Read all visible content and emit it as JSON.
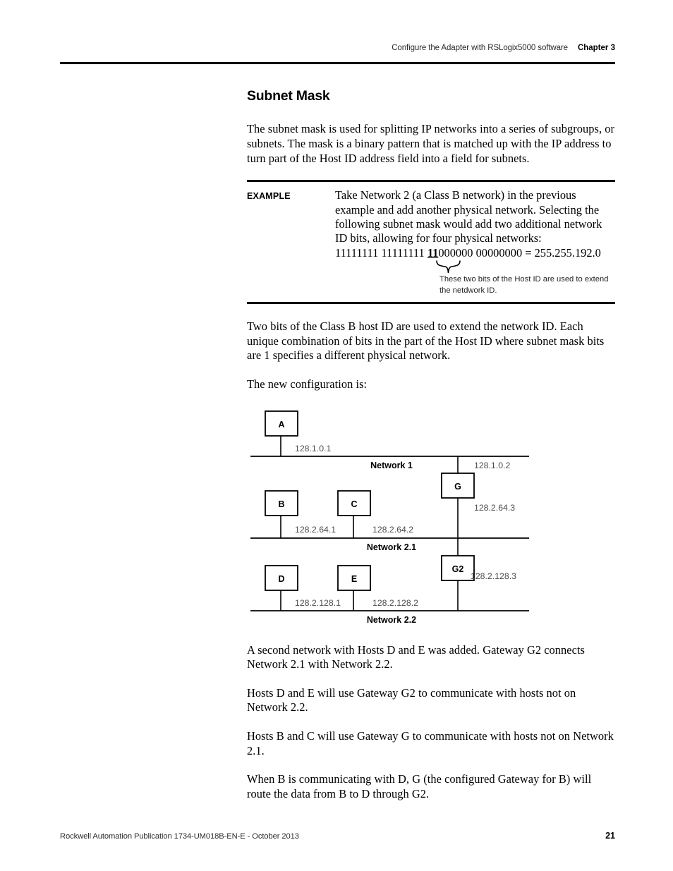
{
  "header": {
    "title": "Configure the Adapter with RSLogix5000 software",
    "chapter": "Chapter 3"
  },
  "section": {
    "title": "Subnet Mask",
    "intro": "The subnet mask is used for splitting IP networks into a series of subgroups, or subnets. The mask is a binary pattern that is matched up with the IP address to turn part of the Host ID address field into a field for subnets."
  },
  "example": {
    "label": "EXAMPLE",
    "text": "Take Network 2 (a Class B network) in the previous example and add another physical network. Selecting the following subnet mask would add two additional network ID bits, allowing for four physical networks:",
    "binary_prefix": "11111111 11111111 ",
    "binary_highlight": "11",
    "binary_suffix": "000000 00000000 = 255.255.192.0",
    "note": "These two bits of the Host ID are used to extend the netdwork ID."
  },
  "paragraphs": {
    "after_example": "Two bits of the Class B host ID are used to extend the network ID. Each unique combination of bits in the part of the Host ID where subnet mask bits are 1 specifies a different physical network.",
    "lead_in": "The new configuration is:",
    "p1": "A second network with Hosts D and E was added. Gateway G2 connects Network 2.1 with Network 2.2.",
    "p2": "Hosts D and E will use Gateway G2 to communicate with hosts not on Network 2.2.",
    "p3": "Hosts B and C will use Gateway G to communicate with hosts not on Network 2.1.",
    "p4": "When B is communicating with D, G (the configured Gateway for B) will route the data from B to D through G2."
  },
  "diagram": {
    "nodes": {
      "a": "A",
      "b": "B",
      "c": "C",
      "d": "D",
      "e": "E",
      "g": "G",
      "g2": "G2"
    },
    "networks": {
      "n1": "Network 1",
      "n21": "Network 2.1",
      "n22": "Network 2.2"
    },
    "addresses": {
      "a": "128.1.0.1",
      "g_top": "128.1.0.2",
      "b": "128.2.64.1",
      "c": "128.2.64.2",
      "g_bottom": "128.2.64.3",
      "d": "128.2.128.1",
      "e": "128.2.128.2",
      "g2_bottom": "128.2.128.3"
    }
  },
  "footer": {
    "text": "Rockwell Automation Publication 1734-UM018B-EN-E - October 2013",
    "page": "21"
  }
}
